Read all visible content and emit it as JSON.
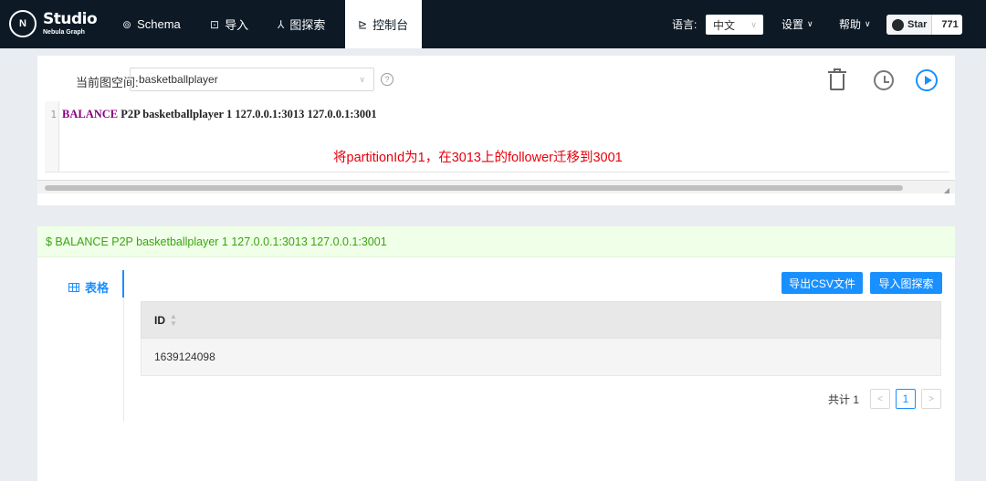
{
  "nav": {
    "logo_mark": "N",
    "logo_title": "Studio",
    "logo_subtitle": "Nebula Graph",
    "items": [
      {
        "label": "Schema",
        "icon": "schema-icon",
        "glyph": "⊚"
      },
      {
        "label": "导入",
        "icon": "import-icon",
        "glyph": "⊡"
      },
      {
        "label": "图探索",
        "icon": "explore-icon",
        "glyph": "⅄"
      },
      {
        "label": "控制台",
        "icon": "console-icon",
        "glyph": "⊵"
      }
    ],
    "active": "控制台",
    "lang_label": "语言:",
    "lang_value": "中文",
    "settings": "设置",
    "help": "帮助",
    "star_label": "Star",
    "star_count": "771"
  },
  "editor": {
    "space_label": "当前图空间:",
    "space_value": "basketballplayer",
    "help_glyph": "?",
    "line_number": "1",
    "code_keyword": "BALANCE",
    "code_rest": " P2P basketballplayer 1 127.0.0.1:3013 127.0.0.1:3001",
    "annotation": "将partitionId为1，在3013上的follower迁移到3001"
  },
  "result": {
    "command": "$ BALANCE P2P basketballplayer 1 127.0.0.1:3013 127.0.0.1:3001",
    "tab_label": "表格",
    "export_csv": "导出CSV文件",
    "import_explore": "导入图探索",
    "columns": [
      "ID"
    ],
    "rows": [
      [
        "1639124098"
      ]
    ],
    "total_text": "共计 1",
    "page": "1",
    "prev": "<",
    "next": ">"
  },
  "colors": {
    "nav_bg": "#0d1a26",
    "primary": "#1990ff",
    "annotation_red": "#e8000b",
    "success_green": "#39a514",
    "keyword_purple": "#8a0080"
  }
}
